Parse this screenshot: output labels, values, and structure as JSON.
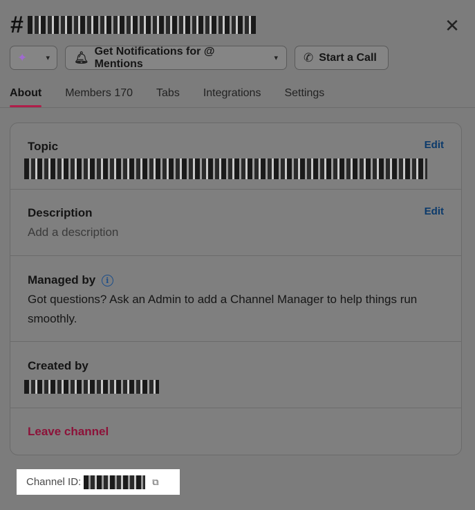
{
  "header": {
    "hash": "#",
    "close_glyph": "✕"
  },
  "actions": {
    "ai_icon": "sparkles-icon",
    "notifications_label": "Get Notifications for @ Mentions",
    "call_label": "Start a Call"
  },
  "tabs": [
    {
      "label": "About",
      "active": true
    },
    {
      "label": "Members 170",
      "active": false
    },
    {
      "label": "Tabs",
      "active": false
    },
    {
      "label": "Integrations",
      "active": false
    },
    {
      "label": "Settings",
      "active": false
    }
  ],
  "about": {
    "topic": {
      "label": "Topic",
      "edit": "Edit"
    },
    "description": {
      "label": "Description",
      "edit": "Edit",
      "placeholder": "Add a description"
    },
    "managed_by": {
      "label": "Managed by",
      "text": "Got questions? Ask an Admin to add a Channel Manager to help things run smoothly."
    },
    "created_by": {
      "label": "Created by"
    },
    "leave": "Leave channel"
  },
  "footer": {
    "channel_id_label": "Channel ID:"
  },
  "colors": {
    "accent_tab": "#b01e4a",
    "leave": "#8c1239",
    "edit_link": "#0b3a6b",
    "overlay": "#7c7c7c"
  }
}
